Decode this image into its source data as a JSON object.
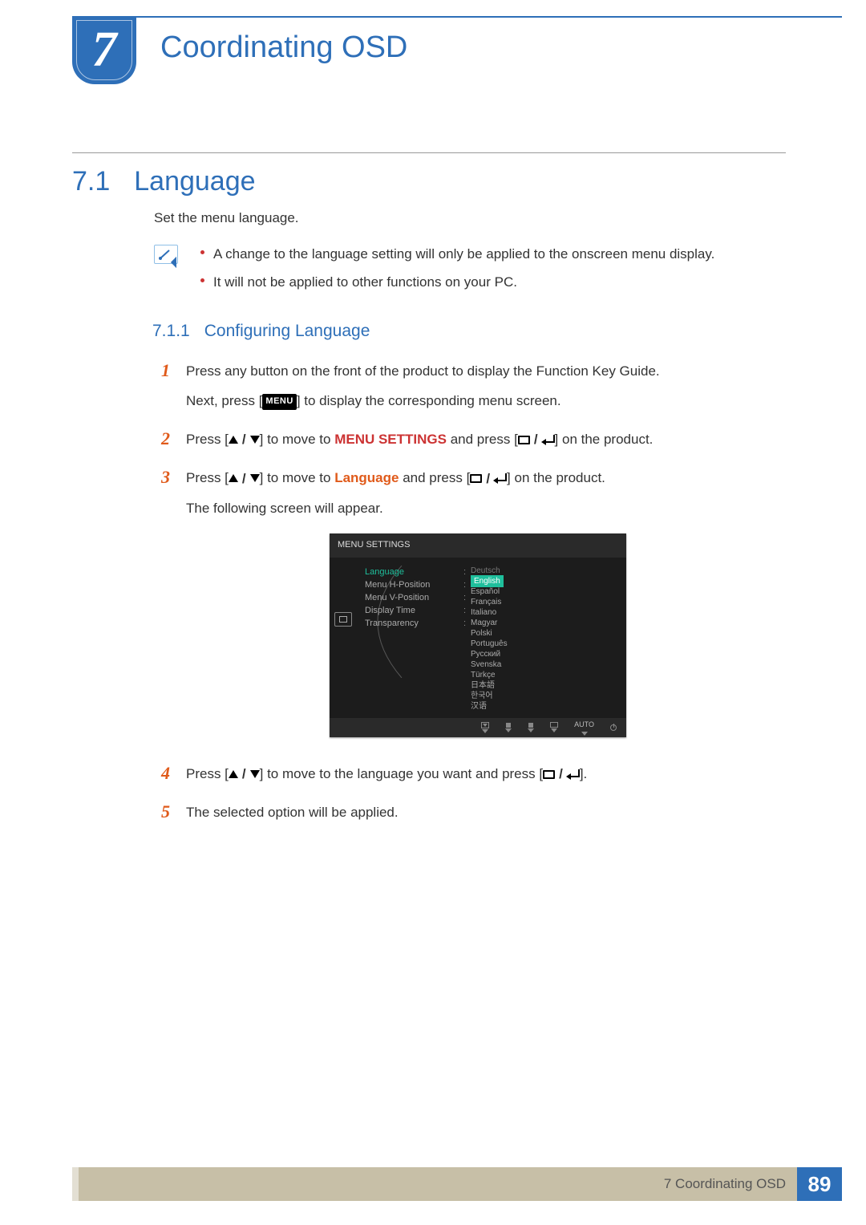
{
  "header": {
    "chapter_number": "7",
    "chapter_title": "Coordinating OSD"
  },
  "section": {
    "number": "7.1",
    "title": "Language",
    "intro": "Set the menu language.",
    "notes": [
      "A change to the language setting will only be applied to the onscreen menu display.",
      "It will not be applied to other functions on your PC."
    ]
  },
  "subsection": {
    "number": "7.1.1",
    "title": "Configuring Language"
  },
  "steps": {
    "s1a": "Press any button on the front of the product to display the Function Key Guide.",
    "s1b_pre": "Next, press [",
    "s1b_post": "] to display the corresponding menu screen.",
    "menu_button_label": "MENU",
    "s2_pre": "Press [",
    "s2_mid": "] to move to ",
    "s2_target": "MENU SETTINGS",
    "s2_post1": " and press [",
    "s2_post2": "] on the product.",
    "s3_pre": "Press [",
    "s3_mid": "] to move to ",
    "s3_target": "Language",
    "s3_post1": " and press [",
    "s3_post2": "] on the product.",
    "s3_tail": "The following screen will appear.",
    "s4_pre": "Press [",
    "s4_mid": "] to move to the language you want and press [",
    "s4_post": "].",
    "s5": "The selected option will be applied.",
    "n1": "1",
    "n2": "2",
    "n3": "3",
    "n4": "4",
    "n5": "5"
  },
  "osd": {
    "title": "MENU SETTINGS",
    "left": [
      "Language",
      "Menu H-Position",
      "Menu V-Position",
      "Display Time",
      "Transparency"
    ],
    "languages": [
      "Deutsch",
      "English",
      "Español",
      "Français",
      "Italiano",
      "Magyar",
      "Polski",
      "Português",
      "Русский",
      "Svenska",
      "Türkçe",
      "日本語",
      "한국어",
      "汉语"
    ],
    "footer_auto": "AUTO"
  },
  "footer": {
    "label": "7 Coordinating OSD",
    "page": "89"
  }
}
